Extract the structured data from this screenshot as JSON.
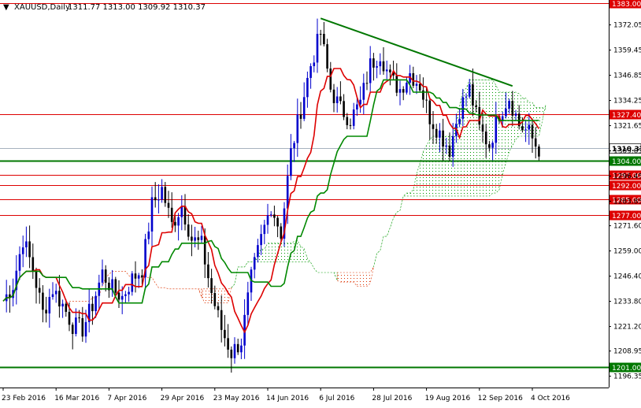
{
  "header": {
    "symbol": "XAUUSD,Daily",
    "ohlc": "1311.77 1313.00 1309.92 1310.37"
  },
  "chart_data": {
    "type": "candlestick",
    "ylim": [
      1190.7,
      1384.5
    ],
    "y_ticks": [
      "1383.00",
      "1372.05",
      "1359.45",
      "1346.85",
      "1334.25",
      "1321.65",
      "1309.05",
      "1296.45",
      "1283.85",
      "1271.60",
      "1259.00",
      "1246.40",
      "1233.80",
      "1221.20",
      "1208.95",
      "1196.35"
    ],
    "x_ticks": [
      {
        "label": "23 Feb 2016",
        "bar": 0
      },
      {
        "label": "16 Mar 2016",
        "bar": 16
      },
      {
        "label": "7 Apr 2016",
        "bar": 32
      },
      {
        "label": "29 Apr 2016",
        "bar": 48
      },
      {
        "label": "23 May 2016",
        "bar": 64
      },
      {
        "label": "14 Jun 2016",
        "bar": 80
      },
      {
        "label": "6 Jul 2016",
        "bar": 96
      },
      {
        "label": "28 Jul 2016",
        "bar": 112
      },
      {
        "label": "19 Aug 2016",
        "bar": 128
      },
      {
        "label": "12 Sep 2016",
        "bar": 144
      },
      {
        "label": "4 Oct 2016",
        "bar": 160
      }
    ],
    "horizontal_levels": [
      {
        "value": 1383.0,
        "label": "1383.00",
        "color": "#dd0000",
        "width": 1
      },
      {
        "value": 1327.4,
        "label": "1327.40",
        "color": "#dd0000",
        "width": 1
      },
      {
        "value": 1304.0,
        "label": "1304.00",
        "color": "#007700",
        "width": 2
      },
      {
        "value": 1297.0,
        "label": "1297.00",
        "color": "#dd0000",
        "width": 1
      },
      {
        "value": 1292.0,
        "label": "1292.00",
        "color": "#dd0000",
        "width": 1
      },
      {
        "value": 1285.0,
        "label": "1285.00",
        "color": "#dd0000",
        "width": 1
      },
      {
        "value": 1277.0,
        "label": "1277.00",
        "color": "#dd0000",
        "width": 1
      },
      {
        "value": 1201.0,
        "label": "1201.00",
        "color": "#007700",
        "width": 2
      }
    ],
    "current_price": {
      "value": 1310.37,
      "label": "1310.37"
    },
    "trendline": {
      "from": {
        "bar": 96,
        "value": 1375.3
      },
      "to": {
        "bar": 154,
        "value": 1341.5
      },
      "color": "#007700"
    },
    "candle_anchors": [
      [
        0,
        1234
      ],
      [
        3,
        1242
      ],
      [
        6,
        1265
      ],
      [
        9,
        1250
      ],
      [
        12,
        1228
      ],
      [
        15,
        1240
      ],
      [
        18,
        1232
      ],
      [
        21,
        1222
      ],
      [
        24,
        1220
      ],
      [
        27,
        1232
      ],
      [
        30,
        1248
      ],
      [
        33,
        1240
      ],
      [
        36,
        1236
      ],
      [
        39,
        1245
      ],
      [
        42,
        1250
      ],
      [
        45,
        1282
      ],
      [
        48,
        1290
      ],
      [
        51,
        1272
      ],
      [
        54,
        1282
      ],
      [
        57,
        1265
      ],
      [
        60,
        1262
      ],
      [
        63,
        1238
      ],
      [
        66,
        1220
      ],
      [
        69,
        1208
      ],
      [
        72,
        1214
      ],
      [
        75,
        1245
      ],
      [
        78,
        1265
      ],
      [
        81,
        1282
      ],
      [
        84,
        1268
      ],
      [
        87,
        1308
      ],
      [
        90,
        1330
      ],
      [
        93,
        1352
      ],
      [
        96,
        1368
      ],
      [
        99,
        1340
      ],
      [
        102,
        1330
      ],
      [
        105,
        1325
      ],
      [
        108,
        1333
      ],
      [
        111,
        1352
      ],
      [
        114,
        1358
      ],
      [
        117,
        1345
      ],
      [
        120,
        1340
      ],
      [
        123,
        1348
      ],
      [
        126,
        1342
      ],
      [
        129,
        1326
      ],
      [
        132,
        1318
      ],
      [
        135,
        1310
      ],
      [
        138,
        1330
      ],
      [
        141,
        1340
      ],
      [
        144,
        1320
      ],
      [
        147,
        1312
      ],
      [
        150,
        1328
      ],
      [
        153,
        1336
      ],
      [
        156,
        1322
      ],
      [
        159,
        1318
      ],
      [
        161,
        1312
      ],
      [
        162,
        1310
      ]
    ],
    "series": [
      {
        "type": "line",
        "color": "#dd0000"
      },
      {
        "type": "line",
        "color": "#008800"
      },
      {
        "type": "cloud",
        "up_color": "#009900",
        "down_color": "#dd3300"
      }
    ]
  }
}
